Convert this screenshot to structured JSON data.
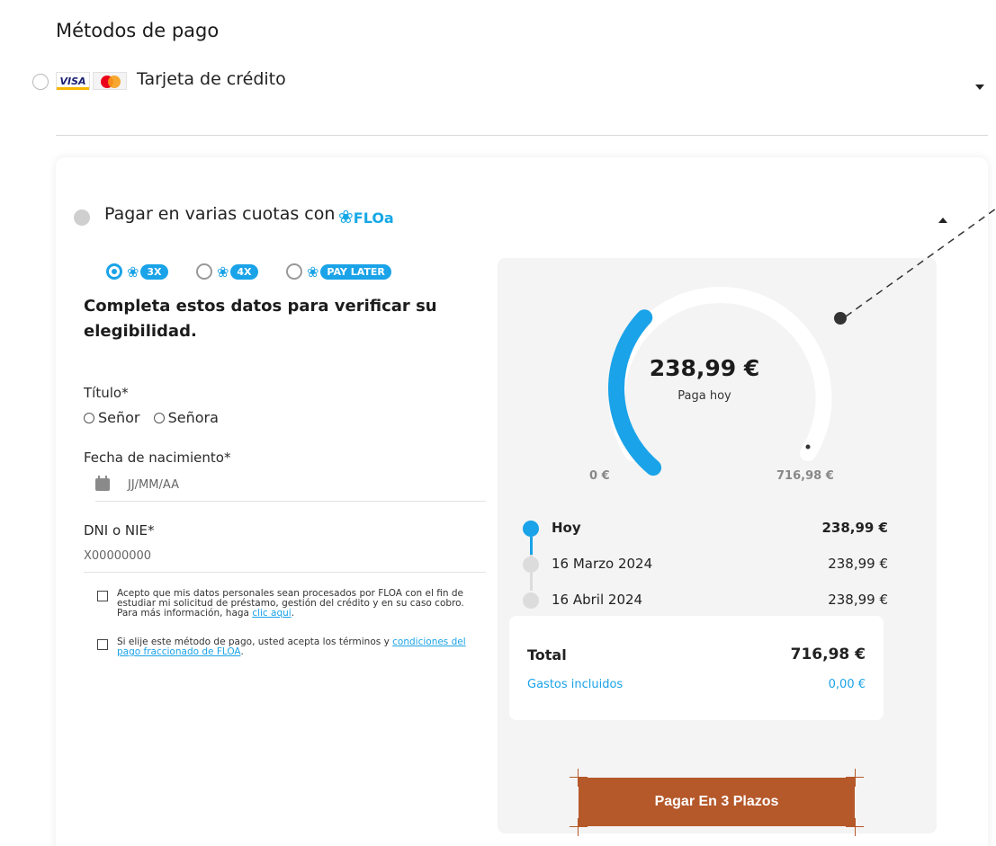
{
  "section": {
    "title": "Métodos de pago"
  },
  "credit_card": {
    "label": "Tarjeta de crédito",
    "visa_text": "VISA"
  },
  "floa": {
    "label": "Pagar en varias cuotas con",
    "logo_text": "FLOa",
    "plans": [
      {
        "label": "3X",
        "selected": true
      },
      {
        "label": "4X",
        "selected": false
      },
      {
        "label": "PAY LATER",
        "selected": false
      }
    ]
  },
  "form": {
    "title": "Completa estos datos para verificar su elegibilidad.",
    "title_field_label": "Título*",
    "title_options": [
      "Señor",
      "Señora"
    ],
    "dob_label": "Fecha de nacimiento*",
    "dob_placeholder": "JJ/MM/AA",
    "dni_label": "DNI o NIE*",
    "dni_placeholder": "X00000000",
    "consent1_text": "Acepto que mis datos personales sean procesados por FLOA con el fin de estudiar mi solicitud de préstamo, gestión del crédito y en su caso cobro. Para más información, haga ",
    "consent1_link": "clic aqui",
    "consent1_end": ".",
    "consent2_text": "Si elije este método de pago, usted acepta los términos y ",
    "consent2_link": "condiciones del pago fraccionado de FLOA",
    "consent2_end": "."
  },
  "summary": {
    "pay_today_amount": "238,99 €",
    "pay_today_label": "Paga hoy",
    "gauge_min": "0 €",
    "gauge_max": "716,98 €",
    "gauge_fraction": 0.333,
    "schedule": [
      {
        "date": "Hoy",
        "amount": "238,99 €"
      },
      {
        "date": "16 Marzo 2024",
        "amount": "238,99 €"
      },
      {
        "date": "16 Abril 2024",
        "amount": "238,99 €"
      }
    ],
    "total_label": "Total",
    "total_amount": "716,98 €",
    "fees_label": "Gastos incluidos",
    "fees_amount": "0,00 €"
  },
  "pay_button": {
    "label": "Pagar En 3 Plazos"
  },
  "colors": {
    "accent": "#1aa3e8",
    "button": "#b5582a",
    "summary_bg": "#f4f4f4"
  }
}
